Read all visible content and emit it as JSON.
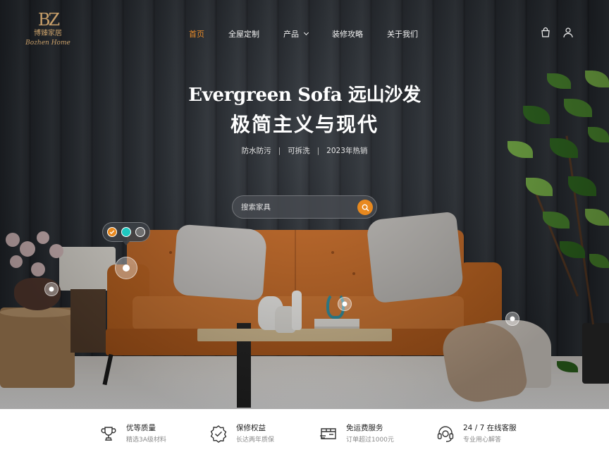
{
  "brand": {
    "logo_mark": "BZ",
    "logo_name": "博臻家居",
    "logo_script": "Bozhen Home"
  },
  "nav": {
    "items": [
      {
        "label": "首页",
        "active": true
      },
      {
        "label": "全屋定制"
      },
      {
        "label": "产品",
        "has_dropdown": true
      },
      {
        "label": "装修攻略"
      },
      {
        "label": "关于我们"
      }
    ],
    "icons": [
      "shopping-bag-icon",
      "user-icon"
    ],
    "accent_color": "#e88b2a"
  },
  "hero": {
    "title_line1": "Evergreen Sofa 远山沙发",
    "title_line2": "极简主义与现代",
    "tags": [
      "防水防污",
      "可拆洗",
      "2023年热销"
    ],
    "tag_separator": "|"
  },
  "search": {
    "placeholder": "搜索家具",
    "value": "",
    "button_color": "#e8891f"
  },
  "swatches": [
    {
      "color": "#e8891f",
      "selected": true
    },
    {
      "color": "#1fc7c0",
      "selected": false
    },
    {
      "color": "#6f6f6f",
      "selected": false
    }
  ],
  "features": [
    {
      "icon": "trophy-icon",
      "title": "优等质量",
      "subtitle": "精选3A级材料"
    },
    {
      "icon": "shield-check-icon",
      "title": "保修权益",
      "subtitle": "长达两年质保"
    },
    {
      "icon": "delivery-box-icon",
      "title": "免运费服务",
      "subtitle": "订单超过1000元"
    },
    {
      "icon": "headset-icon",
      "title": "24 / 7 在线客服",
      "subtitle": "专业用心解答"
    }
  ]
}
